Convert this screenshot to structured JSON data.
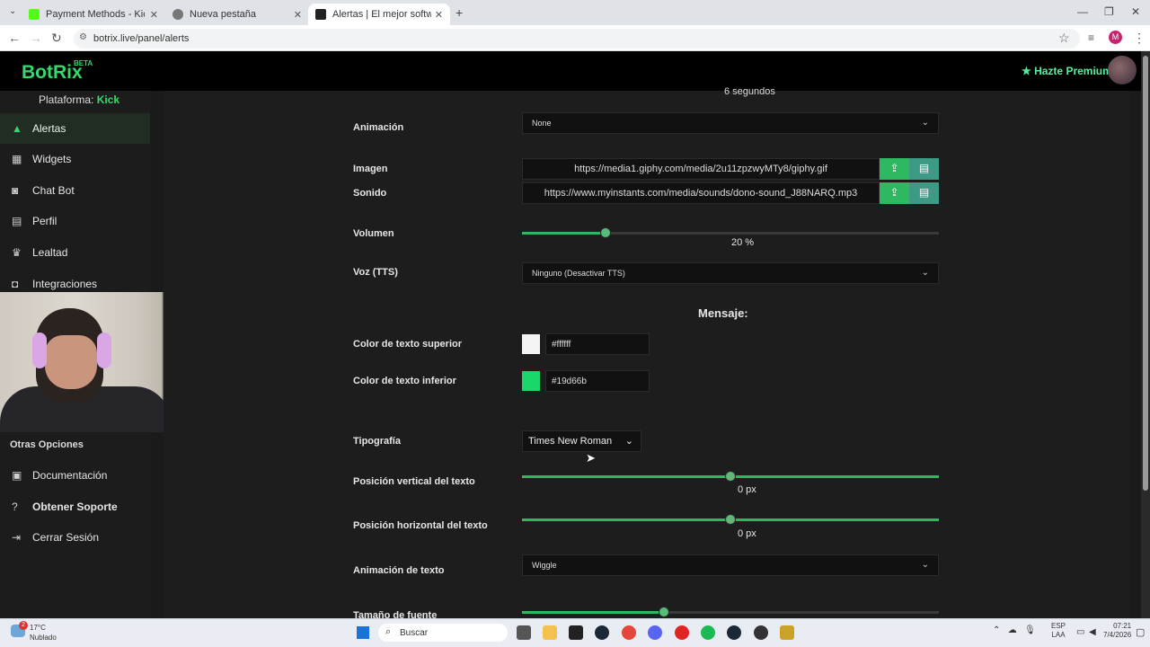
{
  "browser": {
    "tabs": [
      {
        "title": "Payment Methods - Kick Stream",
        "favicon_color": "#53fc18"
      },
      {
        "title": "Nueva pestaña",
        "favicon_color": "#666666"
      },
      {
        "title": "Alertas | El mejor software para",
        "favicon_color": "#222222"
      }
    ],
    "url": "botrix.live/panel/alerts",
    "profile_initial": "M"
  },
  "header": {
    "logo": "BotRix",
    "beta": "BETA",
    "premium_label": "Hazte Premium"
  },
  "sidebar": {
    "platform_label": "Plataforma:",
    "platform_value": "Kick",
    "items": [
      {
        "label": "Alertas",
        "icon": "warning-icon"
      },
      {
        "label": "Widgets",
        "icon": "grid-icon"
      },
      {
        "label": "Chat Bot",
        "icon": "robot-icon"
      },
      {
        "label": "Perfil",
        "icon": "id-card-icon"
      },
      {
        "label": "Lealtad",
        "icon": "trophy-icon"
      },
      {
        "label": "Integraciones",
        "icon": "plug-icon"
      }
    ],
    "section_other": "Otras Opciones",
    "other_items": [
      {
        "label": "Documentación",
        "icon": "book-icon"
      },
      {
        "label": "Obtener Soporte",
        "icon": "help-icon"
      },
      {
        "label": "Cerrar Sesión",
        "icon": "logout-icon"
      }
    ]
  },
  "form": {
    "duration_text": "6 segundos",
    "animation": {
      "label": "Animación",
      "value": "None"
    },
    "image": {
      "label": "Imagen",
      "value": "https://media1.giphy.com/media/2u11zpzwyMTy8/giphy.gif"
    },
    "sound": {
      "label": "Sonido",
      "value": "https://www.myinstants.com/media/sounds/dono-sound_J88NARQ.mp3"
    },
    "volume": {
      "label": "Volumen",
      "value": 20,
      "unit": "%",
      "display": "20  %"
    },
    "tts": {
      "label": "Voz (TTS)",
      "value": "Ninguno (Desactivar TTS)"
    },
    "message_heading": "Mensaje:",
    "top_color": {
      "label": "Color de texto superior",
      "value": "#ffffff"
    },
    "bottom_color": {
      "label": "Color de texto inferior",
      "value": "#19d66b"
    },
    "font": {
      "label": "Tipografía",
      "value": "Times New Roman"
    },
    "vertical_pos": {
      "label": "Posición vertical del texto",
      "value": 0,
      "display": "0  px",
      "fraction": 0.5
    },
    "horizontal_pos": {
      "label": "Posición horizontal del texto",
      "value": 0,
      "display": "0  px",
      "fraction": 0.5
    },
    "text_animation": {
      "label": "Animación de texto",
      "value": "Wiggle"
    },
    "font_size": {
      "label": "Tamaño de fuente",
      "fraction": 0.34
    }
  },
  "taskbar": {
    "temp": "17°C",
    "weather": "Nublado",
    "badge": "2",
    "search_placeholder": "Buscar",
    "lang1": "ESP",
    "lang2": "LAA",
    "time": "07:21",
    "date": "7/4/2026"
  }
}
